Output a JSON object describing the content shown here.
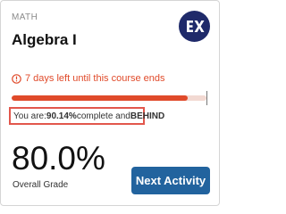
{
  "course": {
    "subject": "MATH",
    "title": "Algebra I",
    "logo": "exponent-logo-icon"
  },
  "deadline": {
    "icon": "alert-circle-icon",
    "text": "7 days left until this course ends"
  },
  "progress": {
    "fraction": 0.9014,
    "prefix": "You are: ",
    "percent": "90.14%",
    "middle": " complete and ",
    "status": "BEHIND"
  },
  "grade": {
    "value": "80.0%",
    "label": "Overall Grade"
  },
  "actions": {
    "next_label": "Next Activity"
  },
  "colors": {
    "accent": "#22639e",
    "warning": "#e04a2a",
    "logo_bg": "#1f2a6a"
  }
}
